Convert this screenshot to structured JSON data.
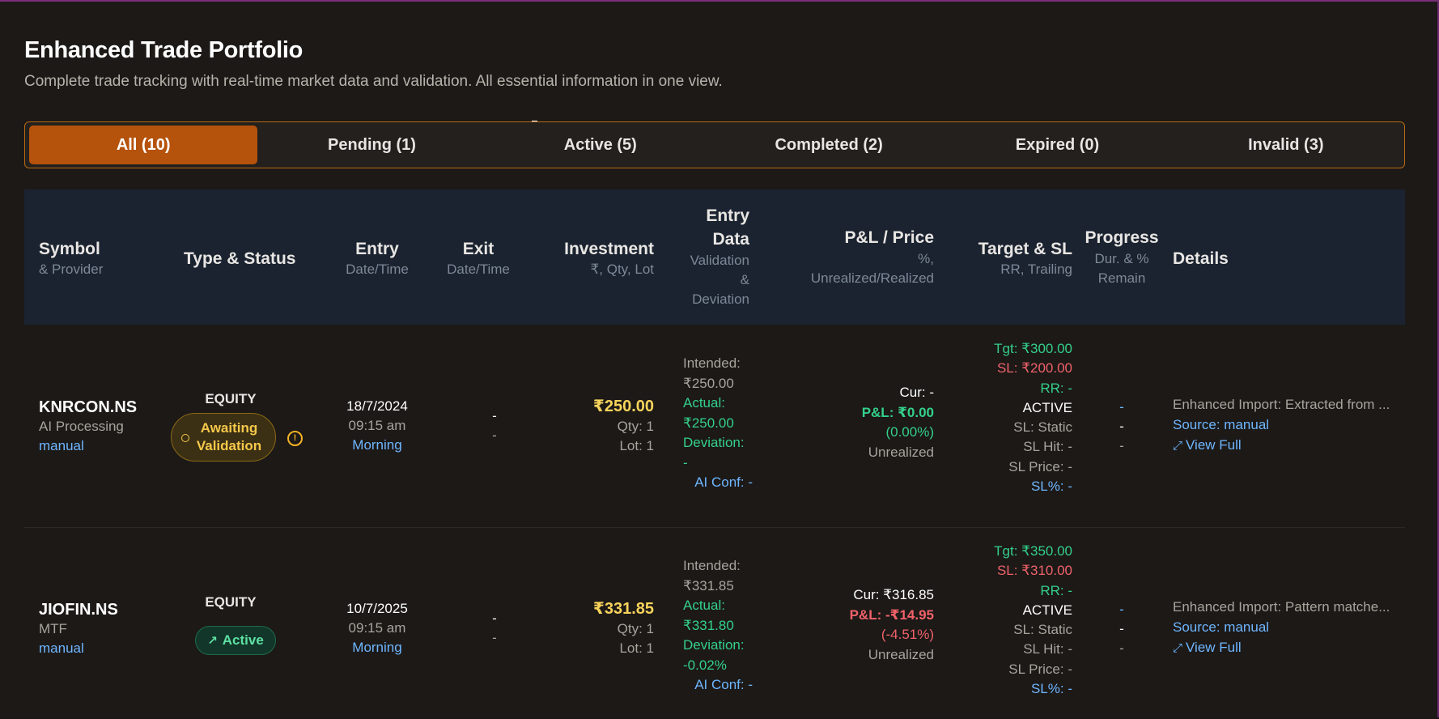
{
  "header": {
    "title": "Enhanced Trade Portfolio",
    "subtitle": "Complete trade tracking with real-time market data and validation. All essential information in one view."
  },
  "tabs": [
    {
      "label": "All (10)"
    },
    {
      "label": "Pending (1)"
    },
    {
      "label": "Active (5)"
    },
    {
      "label": "Completed (2)"
    },
    {
      "label": "Expired (0)"
    },
    {
      "label": "Invalid (3)"
    }
  ],
  "columns": {
    "symbol": {
      "title": "Symbol",
      "sub": "& Provider"
    },
    "type": {
      "title": "Type & Status"
    },
    "entry": {
      "title": "Entry",
      "sub": "Date/Time"
    },
    "exit": {
      "title": "Exit",
      "sub": "Date/Time"
    },
    "investment": {
      "title": "Investment",
      "sub": "₹, Qty, Lot"
    },
    "entry_data": {
      "title1": "Entry",
      "title2": "Data",
      "sub1": "Validation",
      "sub2": "&",
      "sub3": "Deviation"
    },
    "pnl": {
      "title": "P&L / Price",
      "sub1": "%,",
      "sub2": "Unrealized/Realized"
    },
    "target": {
      "title": "Target & SL",
      "sub": "RR, Trailing"
    },
    "progress": {
      "title": "Progress",
      "sub1": "Dur. & %",
      "sub2": "Remain"
    },
    "details": {
      "title": "Details"
    }
  },
  "rows": [
    {
      "symbol": "KNRCON.NS",
      "provider": "AI Processing",
      "source": "manual",
      "type": "EQUITY",
      "status1": "Awaiting",
      "status2": "Validation",
      "entry_date": "18/7/2024",
      "entry_time": "09:15 am",
      "entry_session": "Morning",
      "exit_date": "-",
      "exit_time": "-",
      "investment": "₹250.00",
      "qty": "Qty: 1",
      "lot": "Lot: 1",
      "intended_label": "Intended:",
      "intended_value": "₹250.00",
      "actual_label": "Actual:",
      "actual_value": "₹250.00",
      "deviation_label": "Deviation:",
      "deviation_value": "-",
      "ai_conf": "AI Conf: -",
      "cur": "Cur: -",
      "pnl": "P&L: ₹0.00",
      "pnl_pct": "(0.00%)",
      "pnl_type": "Unrealized",
      "tgt": "Tgt: ₹300.00",
      "sl": "SL: ₹200.00",
      "rr": "RR: -",
      "state": "ACTIVE",
      "sl_static": "SL: Static",
      "sl_hit": "SL Hit: -",
      "sl_price": "SL Price: -",
      "sl_pct": "SL%: -",
      "prog1": "-",
      "prog2": "-",
      "prog3": "-",
      "detail": "Enhanced Import: Extracted from ...",
      "detail_source": "Source: manual",
      "view_full": "View Full"
    },
    {
      "symbol": "JIOFIN.NS",
      "provider": "MTF",
      "source": "manual",
      "type": "EQUITY",
      "status": "Active",
      "entry_date": "10/7/2025",
      "entry_time": "09:15 am",
      "entry_session": "Morning",
      "exit_date": "-",
      "exit_time": "-",
      "investment": "₹331.85",
      "qty": "Qty: 1",
      "lot": "Lot: 1",
      "intended_label": "Intended:",
      "intended_value": "₹331.85",
      "actual_label": "Actual:",
      "actual_value": "₹331.80",
      "deviation_label": "Deviation:",
      "deviation_value": "-0.02%",
      "ai_conf": "AI Conf: -",
      "cur": "Cur: ₹316.85",
      "pnl": "P&L: -₹14.95",
      "pnl_pct": "(-4.51%)",
      "pnl_type": "Unrealized",
      "tgt": "Tgt: ₹350.00",
      "sl": "SL: ₹310.00",
      "rr": "RR: -",
      "state": "ACTIVE",
      "sl_static": "SL: Static",
      "sl_hit": "SL Hit: -",
      "sl_price": "SL Price: -",
      "sl_pct": "SL%: -",
      "prog1": "-",
      "prog2": "-",
      "prog3": "-",
      "detail": "Enhanced Import: Pattern matche...",
      "detail_source": "Source: manual",
      "view_full": "View Full"
    }
  ],
  "colors": {
    "accent": "#b5520b",
    "positive": "#34d08a",
    "negative": "#f0626a",
    "link": "#6fb6ff",
    "amount": "#f7d35b"
  }
}
